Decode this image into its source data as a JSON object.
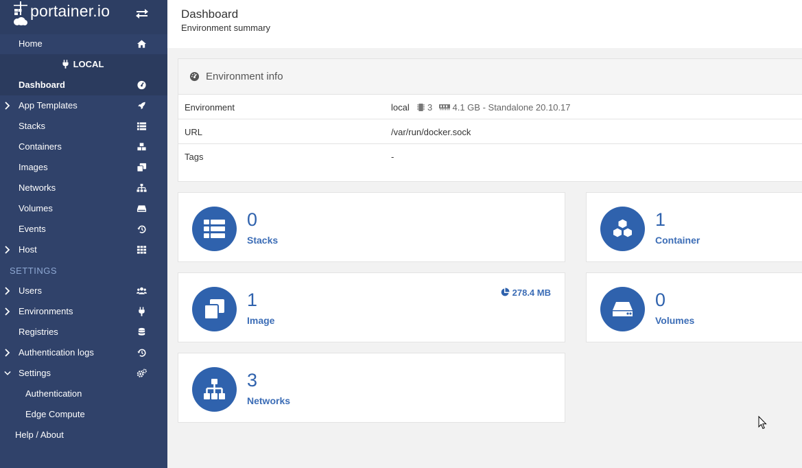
{
  "brand": {
    "name": "portainer.io"
  },
  "sidebar": {
    "home": "Home",
    "environment": "LOCAL",
    "items": [
      {
        "label": "Dashboard",
        "icon": "dashboard-icon"
      },
      {
        "label": "App Templates",
        "icon": "rocket-icon"
      },
      {
        "label": "Stacks",
        "icon": "list-icon"
      },
      {
        "label": "Containers",
        "icon": "cubes-icon"
      },
      {
        "label": "Images",
        "icon": "clone-icon"
      },
      {
        "label": "Networks",
        "icon": "sitemap-icon"
      },
      {
        "label": "Volumes",
        "icon": "hdd-icon"
      },
      {
        "label": "Events",
        "icon": "history-icon"
      },
      {
        "label": "Host",
        "icon": "th-icon"
      }
    ],
    "settings_title": "SETTINGS",
    "settings_items": [
      {
        "label": "Users",
        "icon": "users-icon"
      },
      {
        "label": "Environments",
        "icon": "plug-icon"
      },
      {
        "label": "Registries",
        "icon": "database-icon"
      },
      {
        "label": "Authentication logs",
        "icon": "history-icon"
      },
      {
        "label": "Settings",
        "icon": "cogs-icon"
      },
      {
        "label": "Authentication"
      },
      {
        "label": "Edge Compute"
      }
    ],
    "help": "Help / About"
  },
  "header": {
    "title": "Dashboard",
    "subtitle": "Environment summary"
  },
  "env_info": {
    "title": "Environment info",
    "rows": [
      {
        "key": "Environment",
        "name": "local",
        "cpu": "3",
        "memory": "4.1 GB",
        "detail": "- Standalone 20.10.17"
      },
      {
        "key": "URL",
        "value": "/var/run/docker.sock"
      },
      {
        "key": "Tags",
        "value": "-"
      }
    ]
  },
  "stats": {
    "stacks": {
      "count": "0",
      "label": "Stacks"
    },
    "containers": {
      "count": "1",
      "label": "Container"
    },
    "images": {
      "count": "1",
      "label": "Image",
      "size": "278.4 MB"
    },
    "volumes": {
      "count": "0",
      "label": "Volumes"
    },
    "networks": {
      "count": "3",
      "label": "Networks"
    }
  },
  "colors": {
    "sidebar": "#30426a",
    "accent": "#2f62ad",
    "background": "#f2f2f2"
  }
}
